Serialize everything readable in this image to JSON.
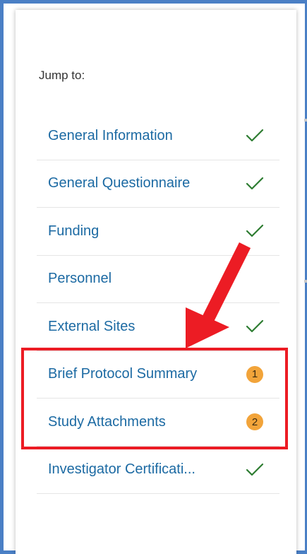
{
  "jump_to_label": "Jump to:",
  "nav_items": [
    {
      "label": "General Information",
      "status": "complete"
    },
    {
      "label": "General Questionnaire",
      "status": "complete"
    },
    {
      "label": "Funding",
      "status": "complete"
    },
    {
      "label": "Personnel",
      "status": "none"
    },
    {
      "label": "External Sites",
      "status": "complete"
    },
    {
      "label": "Brief Protocol Summary",
      "status": "issues",
      "badge": "1"
    },
    {
      "label": "Study Attachments",
      "status": "issues",
      "badge": "2"
    },
    {
      "label": "Investigator Certificati...",
      "status": "complete"
    }
  ],
  "colors": {
    "link": "#1c6aa3",
    "check": "#2e7d32",
    "badge": "#f2a43a",
    "annotation": "#ec1c24",
    "frame": "#4a7fc5"
  },
  "icons": {
    "complete": "checkmark-icon",
    "issues": "count-badge"
  }
}
